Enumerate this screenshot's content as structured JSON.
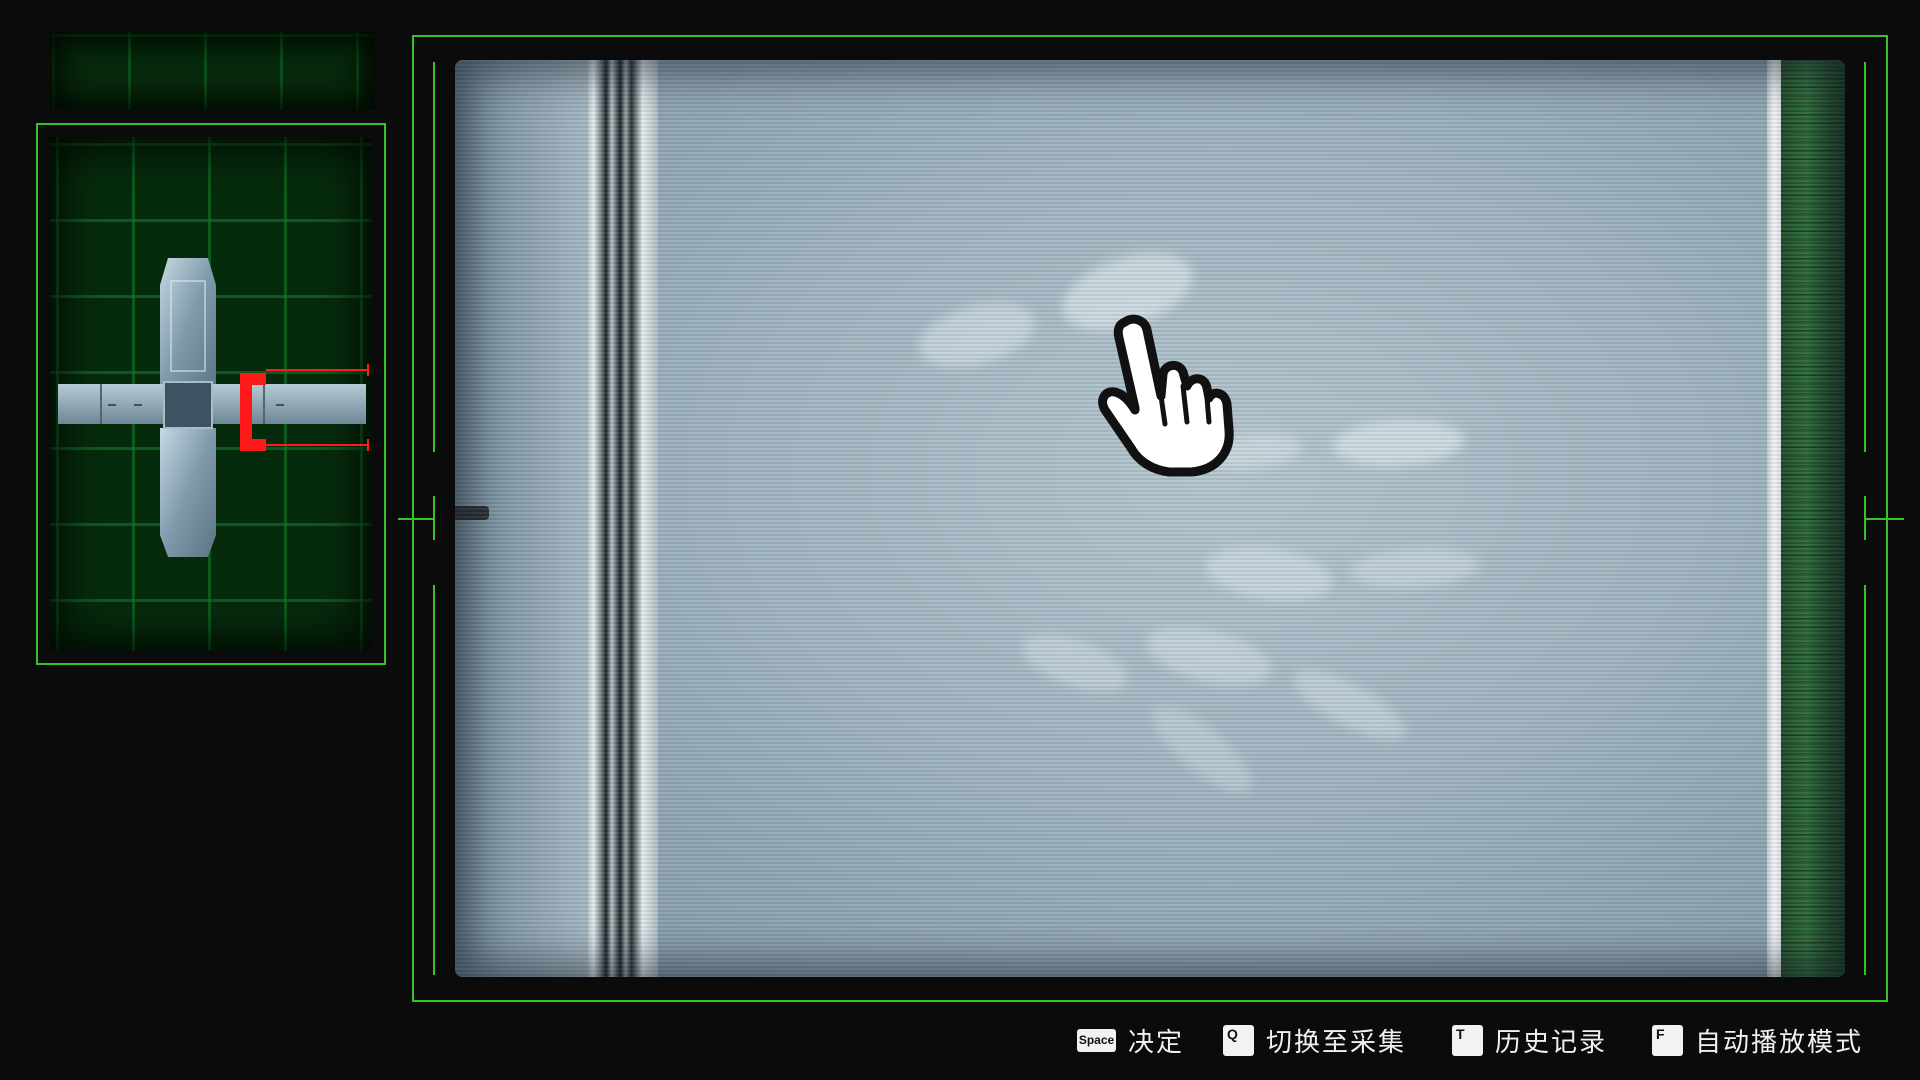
{
  "minimap": {
    "map_icon": "cross-shaped-room-map",
    "player_marker_icon": "red-bracket-marker",
    "accent_color": "#39c12c",
    "marker_color": "#ff1a1a"
  },
  "monitor": {
    "feed_icon": "footprints-camera-feed",
    "cursor_icon": "pointing-hand-icon",
    "frame_color": "#39c12c"
  },
  "hints": [
    {
      "key": "Space",
      "label": "决定"
    },
    {
      "key": "Q",
      "label": "切换至采集"
    },
    {
      "key": "T",
      "label": "历史记录"
    },
    {
      "key": "F",
      "label": "自动播放模式"
    }
  ]
}
